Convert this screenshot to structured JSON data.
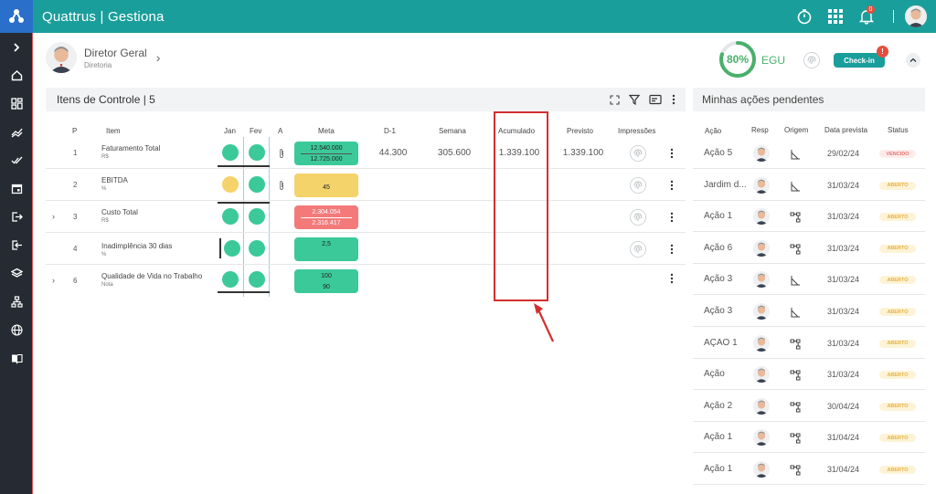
{
  "app": {
    "brand": "Quattrus | Gestiona",
    "notification_count": "0"
  },
  "user": {
    "name": "Diretor Geral",
    "role": "Diretoria"
  },
  "performance": {
    "percent": "80%",
    "label": "EGU",
    "value": 0.8,
    "color": "#47b06a"
  },
  "checkin": {
    "label": "Check-in",
    "badge": "!"
  },
  "control_panel": {
    "title": "Itens de Controle | 5",
    "columns": {
      "p": "P",
      "item": "Item",
      "jan": "Jan",
      "fev": "Fev",
      "a": "A",
      "meta": "Meta",
      "d1": "D-1",
      "semana": "Semana",
      "acumulado": "Acumulado",
      "previsto": "Previsto",
      "impressoes": "Impressões"
    },
    "rows": [
      {
        "p": "1",
        "name": "Faturamento Total",
        "unit": "R$",
        "jan": "green",
        "fev": "green",
        "meta_top": "12.540.000",
        "meta_bottom": "12.725.000",
        "meta_color": "green",
        "d1": "44.300",
        "semana": "305.600",
        "acumulado": "1.339.100",
        "previsto": "1.339.100",
        "expandable": false
      },
      {
        "p": "2",
        "name": "EBITDA",
        "unit": "%",
        "jan": "yellow",
        "fev": "green",
        "meta_top": "",
        "meta_bottom": "45",
        "meta_color": "yellow",
        "d1": "",
        "semana": "",
        "acumulado": "",
        "previsto": "",
        "expandable": false
      },
      {
        "p": "3",
        "name": "Custo Total",
        "unit": "R$",
        "jan": "green",
        "fev": "green",
        "meta_top": "2.304.054",
        "meta_bottom": "2.316.417",
        "meta_color": "red",
        "d1": "",
        "semana": "",
        "acumulado": "",
        "previsto": "",
        "expandable": true
      },
      {
        "p": "4",
        "name": "Inadimplência 30 dias",
        "unit": "%",
        "jan": "green",
        "fev": "green",
        "meta_top": "2,5",
        "meta_bottom": "",
        "meta_color": "green",
        "d1": "",
        "semana": "",
        "acumulado": "",
        "previsto": "",
        "expandable": false
      },
      {
        "p": "6",
        "name": "Qualidade de Vida no Trabalho",
        "unit": "Nota",
        "jan": "green",
        "fev": "green",
        "meta_top": "100",
        "meta_bottom": "90",
        "meta_color": "green",
        "d1": "",
        "semana": "",
        "acumulado": "",
        "previsto": "",
        "expandable": true
      }
    ]
  },
  "actions_panel": {
    "title": "Minhas ações pendentes",
    "columns": {
      "acao": "Ação",
      "resp": "Resp",
      "origem": "Origem",
      "data": "Data prevista",
      "status": "Status"
    },
    "rows": [
      {
        "acao": "Ação 5",
        "origem": "analysis",
        "data": "29/02/24",
        "status": "VENCIDO"
      },
      {
        "acao": "Jardim d...",
        "origem": "analysis",
        "data": "31/03/24",
        "status": "ABERTO"
      },
      {
        "acao": "Ação 1",
        "origem": "hierarchy",
        "data": "31/03/24",
        "status": "ABERTO"
      },
      {
        "acao": "Ação 6",
        "origem": "hierarchy",
        "data": "31/03/24",
        "status": "ABERTO"
      },
      {
        "acao": "Ação 3",
        "origem": "analysis",
        "data": "31/03/24",
        "status": "ABERTO"
      },
      {
        "acao": "Ação 3",
        "origem": "analysis",
        "data": "31/03/24",
        "status": "ABERTO"
      },
      {
        "acao": "AÇÃO 1",
        "origem": "hierarchy",
        "data": "31/03/24",
        "status": "ABERTO"
      },
      {
        "acao": "Ação",
        "origem": "hierarchy",
        "data": "31/03/24",
        "status": "ABERTO"
      },
      {
        "acao": "Ação 2",
        "origem": "hierarchy",
        "data": "30/04/24",
        "status": "ABERTO"
      },
      {
        "acao": "Ação 1",
        "origem": "hierarchy",
        "data": "31/04/24",
        "status": "ABERTO"
      },
      {
        "acao": "Ação 1",
        "origem": "hierarchy",
        "data": "31/04/24",
        "status": "ABERTO"
      }
    ]
  },
  "colors": {
    "teal": "#1a9e9b",
    "green": "#3cc99a",
    "yellow": "#f5d36b",
    "red": "#f47a7a",
    "sidebar": "#262b33",
    "highlight": "#d32f2f"
  }
}
